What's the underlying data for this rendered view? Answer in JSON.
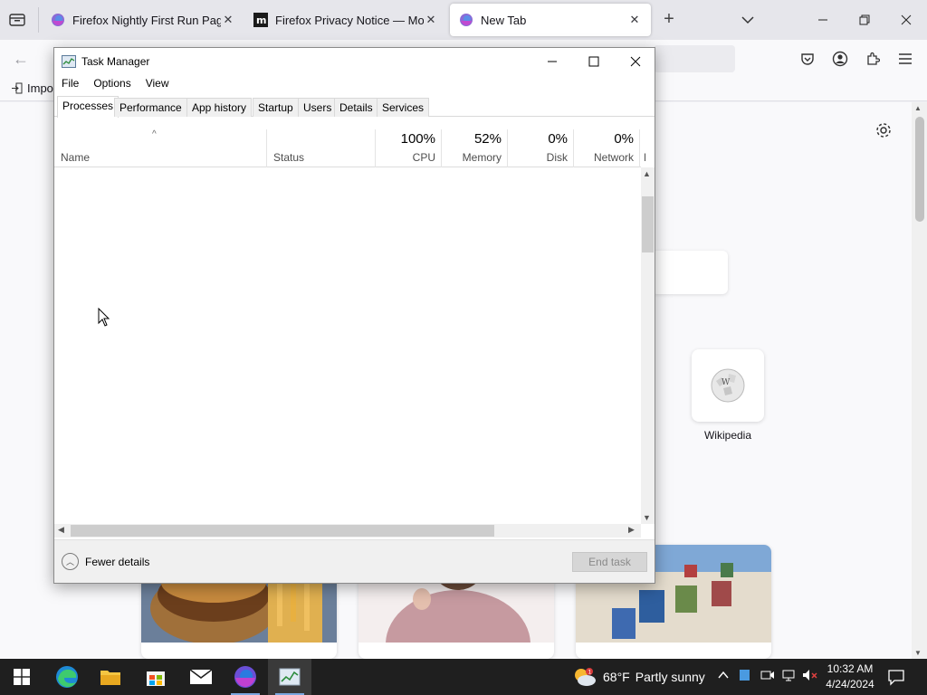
{
  "browser": {
    "tabs": [
      {
        "title": "Firefox Nightly First Run Page",
        "active": false,
        "icon": "firefox-nightly-icon"
      },
      {
        "title": "Firefox Privacy Notice — Mozilla",
        "active": false,
        "icon": "mozilla-m-icon"
      },
      {
        "title": "New Tab",
        "active": true,
        "icon": "firefox-nightly-icon"
      }
    ],
    "bookmarks_import_label": "Impo",
    "shortcut_label": "Wikipedia"
  },
  "task_manager": {
    "title": "Task Manager",
    "menu": [
      "File",
      "Options",
      "View"
    ],
    "tabs": [
      "Processes",
      "Performance",
      "App history",
      "Startup",
      "Users",
      "Details",
      "Services"
    ],
    "active_tab": "Processes",
    "columns": {
      "name": "Name",
      "status": "Status",
      "cpu_pct": "100%",
      "cpu": "CPU",
      "memory_pct": "52%",
      "memory": "Memory",
      "disk_pct": "0%",
      "disk": "Disk",
      "network_pct": "0%",
      "network": "Network",
      "power_partial": "P"
    },
    "fewer_details": "Fewer details",
    "end_task": "End task"
  },
  "taskbar": {
    "weather_temp": "68°F",
    "weather_desc": "Partly sunny",
    "time": "10:32 AM",
    "date": "4/24/2024"
  },
  "colors": {
    "taskbar_bg": "#1f1f1f",
    "firefox_tab_strip": "#e6e6eb",
    "end_task_disabled": "#d6d6d6"
  }
}
